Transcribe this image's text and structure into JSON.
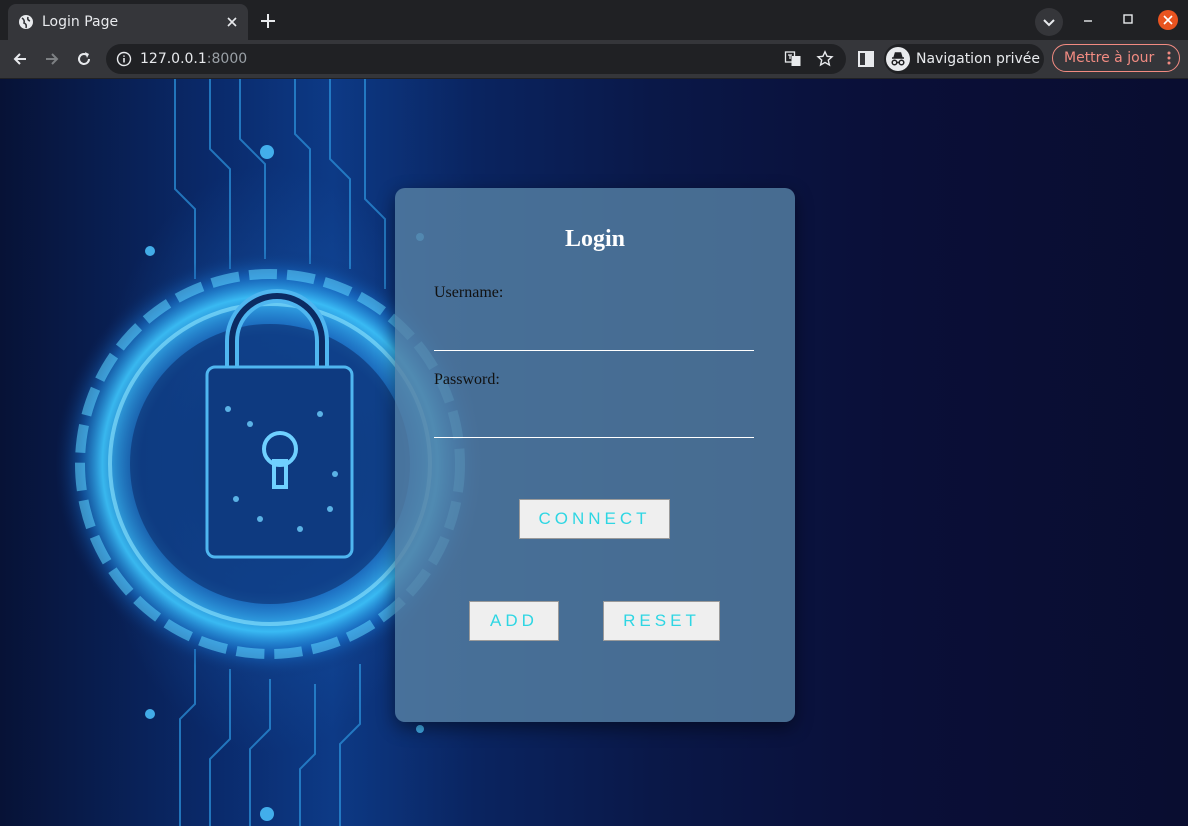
{
  "browser": {
    "tab_title": "Login Page",
    "url_host": "127.0.0.1",
    "url_port": ":8000",
    "incognito_label": "Navigation privée",
    "update_label": "Mettre à jour"
  },
  "login": {
    "title": "Login",
    "username_label": "Username:",
    "username_value": "",
    "password_label": "Password:",
    "password_value": "",
    "connect_label": "CONNECT",
    "add_label": "ADD",
    "reset_label": "RESET"
  },
  "colors": {
    "button_text": "#2ed6e3",
    "card_bg": "#5680a3",
    "update_accent": "#f28b82"
  }
}
